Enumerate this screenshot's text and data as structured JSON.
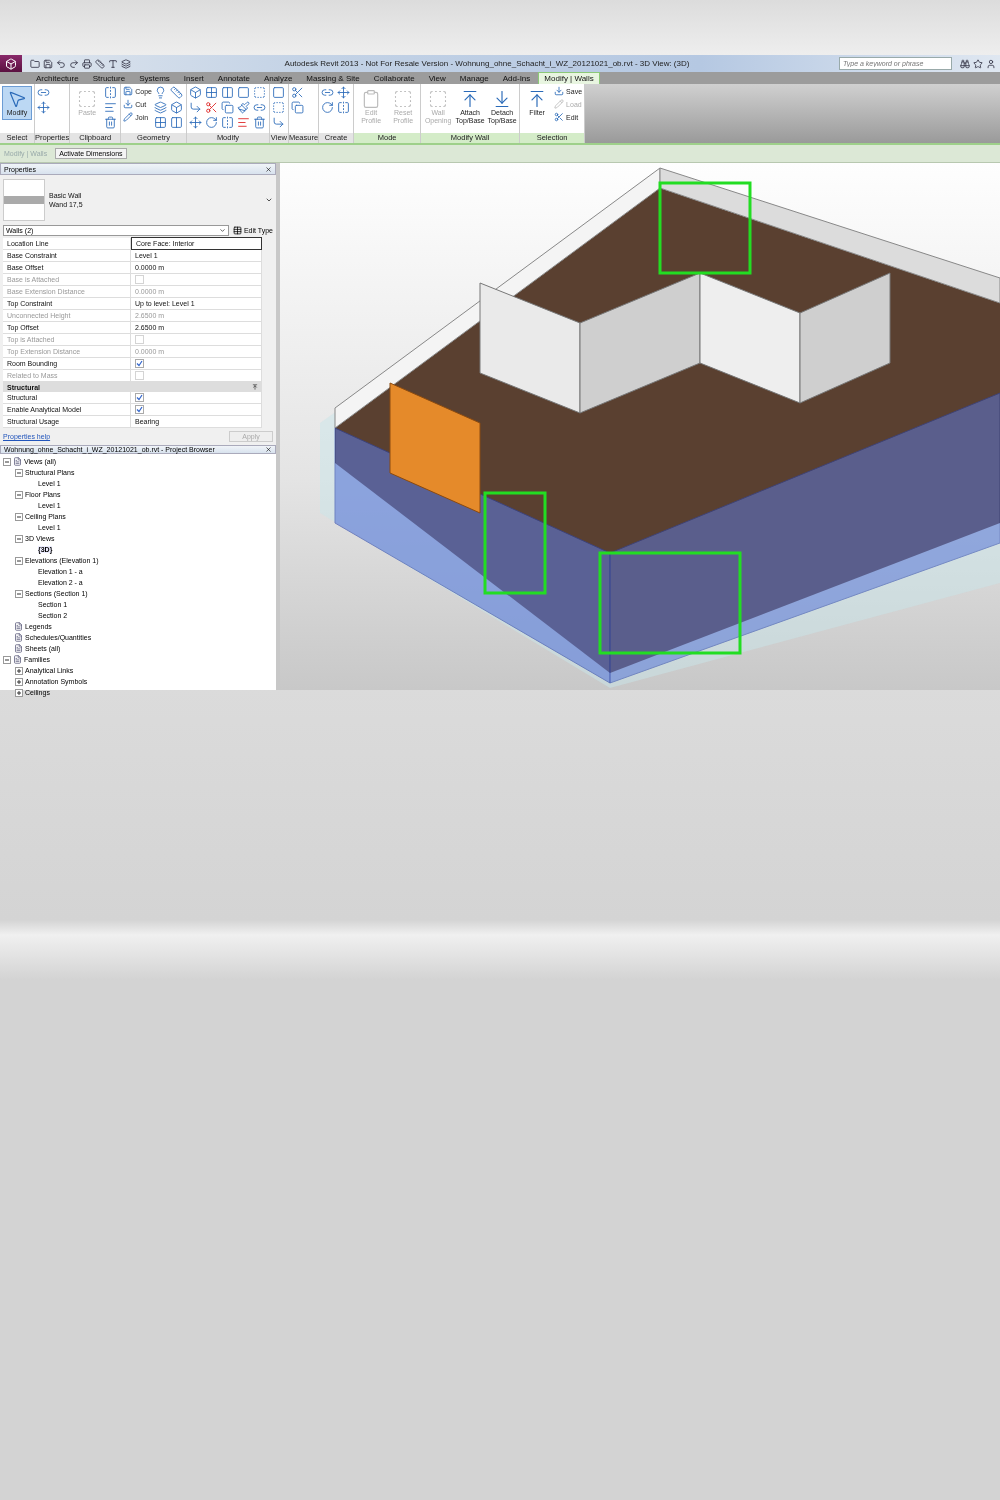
{
  "title_bar": {
    "app_title": "Autodesk Revit 2013 - Not For Resale Version -",
    "document": "Wohnung_ohne_Schacht_i_WZ_20121021_ob.rvt - 3D View: (3D)",
    "search_placeholder": "Type a keyword or phrase"
  },
  "ribbon_tabs": [
    {
      "label": "Architecture",
      "selected": false
    },
    {
      "label": "Structure",
      "selected": false
    },
    {
      "label": "Systems",
      "selected": false
    },
    {
      "label": "Insert",
      "selected": false
    },
    {
      "label": "Annotate",
      "selected": false
    },
    {
      "label": "Analyze",
      "selected": false
    },
    {
      "label": "Massing & Site",
      "selected": false
    },
    {
      "label": "Collaborate",
      "selected": false
    },
    {
      "label": "View",
      "selected": false
    },
    {
      "label": "Manage",
      "selected": false
    },
    {
      "label": "Add-Ins",
      "selected": false
    },
    {
      "label": "Modify | Walls",
      "selected": true
    }
  ],
  "ribbon_panels": [
    {
      "title": "Select",
      "contextual": false,
      "tools": [
        {
          "kind": "large",
          "label": "Modify",
          "disabled": false,
          "active": true
        }
      ]
    },
    {
      "title": "Properties",
      "contextual": false,
      "tools": [
        {
          "kind": "icon"
        },
        {
          "kind": "icon"
        }
      ]
    },
    {
      "title": "Clipboard",
      "contextual": false,
      "tools": [
        {
          "kind": "large",
          "label": "Paste",
          "disabled": true,
          "active": false
        },
        {
          "kind": "icon"
        },
        {
          "kind": "icon"
        },
        {
          "kind": "icon"
        }
      ]
    },
    {
      "title": "Geometry",
      "contextual": false,
      "tools": [
        {
          "kind": "small",
          "label": "Cope",
          "disabled": false
        },
        {
          "kind": "small",
          "label": "Cut",
          "disabled": false
        },
        {
          "kind": "small",
          "label": "Join",
          "disabled": false
        },
        {
          "kind": "icon"
        },
        {
          "kind": "icon"
        },
        {
          "kind": "icon"
        },
        {
          "kind": "icon"
        },
        {
          "kind": "icon"
        },
        {
          "kind": "icon"
        }
      ]
    },
    {
      "title": "Modify",
      "contextual": false,
      "tools": [
        {
          "kind": "icon"
        },
        {
          "kind": "icon"
        },
        {
          "kind": "icon"
        },
        {
          "kind": "icon"
        },
        {
          "kind": "icon"
        },
        {
          "kind": "icon"
        },
        {
          "kind": "icon"
        },
        {
          "kind": "icon"
        },
        {
          "kind": "icon"
        },
        {
          "kind": "icon"
        },
        {
          "kind": "icon"
        },
        {
          "kind": "icon"
        },
        {
          "kind": "icon"
        },
        {
          "kind": "icon"
        },
        {
          "kind": "icon"
        }
      ]
    },
    {
      "title": "View",
      "contextual": false,
      "tools": [
        {
          "kind": "icon"
        },
        {
          "kind": "icon"
        },
        {
          "kind": "icon"
        }
      ]
    },
    {
      "title": "Measure",
      "contextual": false,
      "tools": [
        {
          "kind": "icon"
        },
        {
          "kind": "icon"
        }
      ]
    },
    {
      "title": "Create",
      "contextual": false,
      "tools": [
        {
          "kind": "icon"
        },
        {
          "kind": "icon"
        },
        {
          "kind": "icon"
        },
        {
          "kind": "icon"
        }
      ]
    },
    {
      "title": "Mode",
      "contextual": true,
      "tools": [
        {
          "kind": "large",
          "label": "Edit Profile",
          "disabled": true,
          "active": false
        },
        {
          "kind": "large",
          "label": "Reset Profile",
          "disabled": true,
          "active": false
        }
      ]
    },
    {
      "title": "Modify Wall",
      "contextual": true,
      "tools": [
        {
          "kind": "large",
          "label": "Wall Opening",
          "disabled": true,
          "active": false
        },
        {
          "kind": "large",
          "label": "Attach Top/Base",
          "disabled": false,
          "active": false
        },
        {
          "kind": "large",
          "label": "Detach Top/Base",
          "disabled": false,
          "active": false
        }
      ]
    },
    {
      "title": "Selection",
      "contextual": true,
      "tools": [
        {
          "kind": "large",
          "label": "Filter",
          "disabled": false,
          "active": false
        },
        {
          "kind": "small",
          "label": "Save",
          "disabled": false
        },
        {
          "kind": "small",
          "label": "Load",
          "disabled": true
        },
        {
          "kind": "small",
          "label": "Edit",
          "disabled": false
        }
      ]
    }
  ],
  "options_bar": {
    "context": "Modify | Walls",
    "button": "Activate Dimensions"
  },
  "properties": {
    "title": "Properties",
    "type_family": "Basic Wall",
    "type_name": "Wand 17,5",
    "selector": "Walls (2)",
    "edit_type": "Edit Type",
    "rows": [
      {
        "kind": "text",
        "label": "Location Line",
        "value": "Core Face: Interior",
        "disabled": false,
        "active": true
      },
      {
        "kind": "text",
        "label": "Base Constraint",
        "value": "Level 1",
        "disabled": false,
        "active": false
      },
      {
        "kind": "text",
        "label": "Base Offset",
        "value": "0.0000 m",
        "disabled": false,
        "active": false
      },
      {
        "kind": "check",
        "label": "Base is Attached",
        "checked": false,
        "disabled": true
      },
      {
        "kind": "text",
        "label": "Base Extension Distance",
        "value": "0.0000 m",
        "disabled": true,
        "active": false
      },
      {
        "kind": "text",
        "label": "Top Constraint",
        "value": "Up to level: Level 1",
        "disabled": false,
        "active": false
      },
      {
        "kind": "text",
        "label": "Unconnected Height",
        "value": "2.6500 m",
        "disabled": true,
        "active": false
      },
      {
        "kind": "text",
        "label": "Top Offset",
        "value": "2.6500 m",
        "disabled": false,
        "active": false
      },
      {
        "kind": "check",
        "label": "Top is Attached",
        "checked": false,
        "disabled": true
      },
      {
        "kind": "text",
        "label": "Top Extension Distance",
        "value": "0.0000 m",
        "disabled": true,
        "active": false
      },
      {
        "kind": "check",
        "label": "Room Bounding",
        "checked": true,
        "disabled": false
      },
      {
        "kind": "check",
        "label": "Related to Mass",
        "checked": false,
        "disabled": true
      },
      {
        "kind": "group",
        "label": "Structural",
        "expanded": true
      },
      {
        "kind": "check",
        "label": "Structural",
        "checked": true,
        "disabled": false
      },
      {
        "kind": "check",
        "label": "Enable Analytical Model",
        "checked": true,
        "disabled": false
      },
      {
        "kind": "text",
        "label": "Structural Usage",
        "value": "Bearing",
        "disabled": false,
        "active": false
      }
    ],
    "help_link": "Properties help",
    "apply": "Apply"
  },
  "project_browser": {
    "title": "Wohnung_ohne_Schacht_i_WZ_20121021_ob.rvt - Project Browser",
    "tree": [
      {
        "label": "Views (all)",
        "selected": false,
        "expanded": true,
        "children": [
          {
            "label": "Structural Plans",
            "selected": false,
            "expanded": true,
            "children": [
              {
                "label": "Level 1",
                "selected": false
              }
            ]
          },
          {
            "label": "Floor Plans",
            "selected": false,
            "expanded": true,
            "children": [
              {
                "label": "Level 1",
                "selected": false
              }
            ]
          },
          {
            "label": "Ceiling Plans",
            "selected": false,
            "expanded": true,
            "children": [
              {
                "label": "Level 1",
                "selected": false
              }
            ]
          },
          {
            "label": "3D Views",
            "selected": false,
            "expanded": true,
            "children": [
              {
                "label": "{3D}",
                "selected": true
              }
            ]
          },
          {
            "label": "Elevations (Elevation 1)",
            "selected": false,
            "expanded": true,
            "children": [
              {
                "label": "Elevation 1 - a",
                "selected": false
              },
              {
                "label": "Elevation 2 - a",
                "selected": false
              }
            ]
          },
          {
            "label": "Sections (Section 1)",
            "selected": false,
            "expanded": true,
            "children": [
              {
                "label": "Section 1",
                "selected": false
              },
              {
                "label": "Section 2",
                "selected": false
              }
            ]
          }
        ]
      },
      {
        "label": "Legends",
        "selected": false
      },
      {
        "label": "Schedules/Quantities",
        "selected": false
      },
      {
        "label": "Sheets (all)",
        "selected": false
      },
      {
        "label": "Families",
        "selected": false,
        "expanded": true,
        "children": [
          {
            "label": "Analytical Links",
            "selected": false,
            "expanded": false
          },
          {
            "label": "Annotation Symbols",
            "selected": false,
            "expanded": false
          },
          {
            "label": "Ceilings",
            "selected": false,
            "expanded": false
          }
        ]
      }
    ]
  }
}
